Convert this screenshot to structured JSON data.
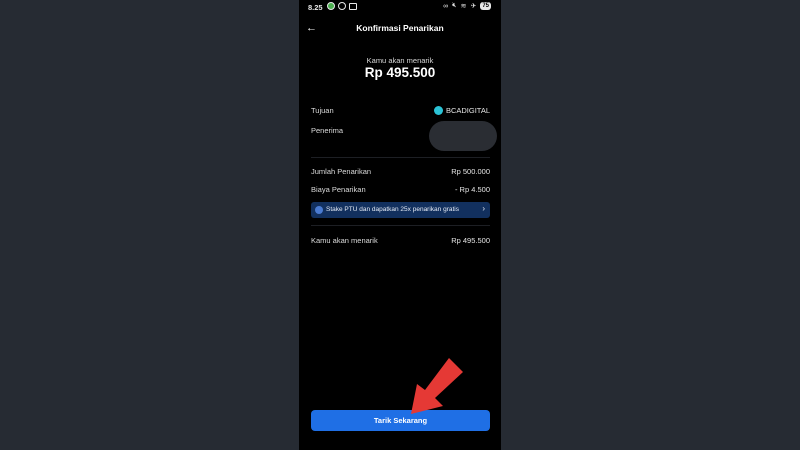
{
  "status_bar": {
    "time": "8.25",
    "battery": "75"
  },
  "header": {
    "back_icon": "arrow-left-icon",
    "title": "Konfirmasi Penarikan"
  },
  "summary": {
    "label": "Kamu akan menarik",
    "amount": "Rp 495.500"
  },
  "destination": {
    "tujuan_label": "Tujuan",
    "bank_name": "BCADIGITAL",
    "penerima_label": "Penerima"
  },
  "details": {
    "jumlah_label": "Jumlah Penarikan",
    "jumlah_value": "Rp 500.000",
    "biaya_label": "Biaya Penarikan",
    "biaya_value": "- Rp 4.500"
  },
  "promo": {
    "text": "Stake PTU dan dapatkan 25x penarikan gratis"
  },
  "total": {
    "label": "Kamu akan menarik",
    "value": "Rp 495.500"
  },
  "cta": {
    "label": "Tarik Sekarang"
  },
  "colors": {
    "primary": "#1f6fe5",
    "promo_bg": "#12305e",
    "annotation_arrow": "#e53935"
  }
}
